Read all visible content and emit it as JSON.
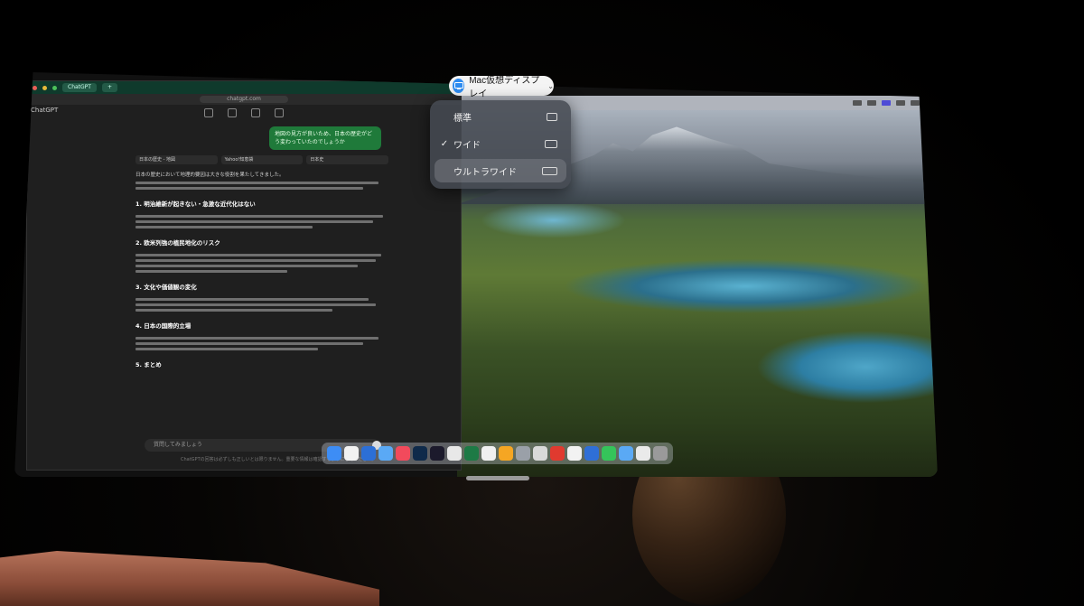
{
  "display_selector": {
    "label": "Mac仮想ディスプレイ",
    "icon": "display-icon",
    "options": [
      {
        "label": "標準",
        "icon": "standard-display-icon",
        "checked": false,
        "highlighted": false
      },
      {
        "label": "ワイド",
        "icon": "wide-display-icon",
        "checked": true,
        "highlighted": false
      },
      {
        "label": "ウルトラワイド",
        "icon": "ultrawide-display-icon",
        "checked": false,
        "highlighted": true
      }
    ],
    "checkmark": "✓"
  },
  "browser": {
    "app_name": "ChatGPT",
    "url": "chatgpt.com",
    "tabs": [
      "ChatGPT",
      "+"
    ],
    "user_message": "地図の見方が良いため、日本の歴史がどう変わっていたのでしょうか",
    "source_chips": [
      "日本の歴史 - 地図",
      "Yahoo!知恵袋",
      "日本史"
    ],
    "intro": "日本の歴史において地理的要因は大きな役割を果たしてきました。",
    "sections": [
      "1. 明治維新が起きない・急激な近代化はない",
      "2. 欧米列強の植民地化のリスク",
      "3. 文化や価値観の変化",
      "4. 日本の国際的立場",
      "5. まとめ"
    ],
    "composer_placeholder": "質問してみましょう",
    "footnote": "ChatGPTの回答は必ずしも正しいとは限りません。重要な情報は確認するようにしてください。"
  },
  "colors": {
    "selector_badge": "#2f8cf0",
    "user_bubble": "#1f7a3a",
    "popup_bg": "#464a52"
  }
}
